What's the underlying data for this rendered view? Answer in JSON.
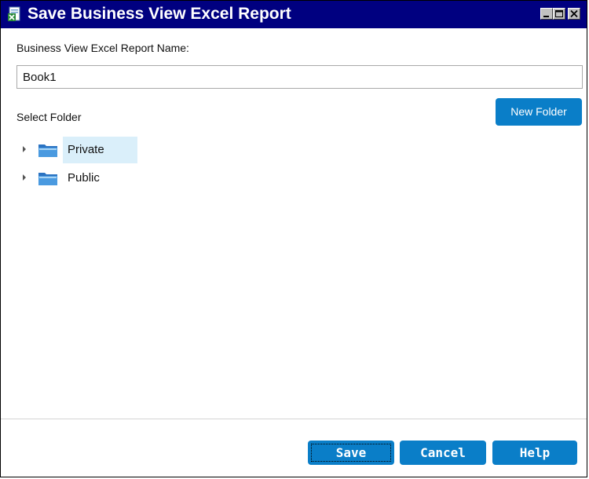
{
  "window": {
    "title": "Save Business View Excel Report",
    "title_icon": "report-app-icon",
    "controls": [
      "minimize-icon",
      "maximize-icon",
      "close-icon"
    ]
  },
  "form": {
    "name_label": "Business View Excel Report Name:",
    "name_value": "Book1",
    "select_folder_label": "Select Folder",
    "new_folder_label": "New Folder"
  },
  "tree": {
    "items": [
      {
        "label": "Private",
        "selected": true,
        "expanded": false,
        "icon": "folder-icon"
      },
      {
        "label": "Public",
        "selected": false,
        "expanded": false,
        "icon": "folder-icon"
      }
    ]
  },
  "footer": {
    "save_label": "Save",
    "cancel_label": "Cancel",
    "help_label": "Help"
  },
  "colors": {
    "titlebar": "#000080",
    "accent_button": "#0a7ec8",
    "selection": "#daeffa"
  }
}
